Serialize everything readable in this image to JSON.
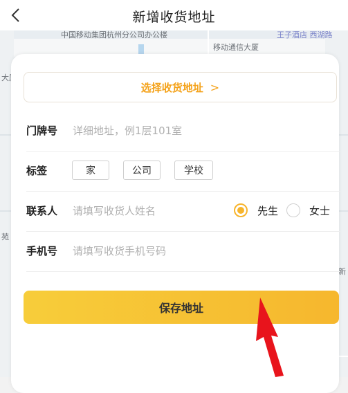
{
  "header": {
    "title": "新增收货地址",
    "back_icon": "chevron-left-icon"
  },
  "map": {
    "labels": {
      "top_left": "中国移动集团杭州分公司办公楼",
      "building": "移动通信大厦",
      "top_right": "王子酒店 西湖路",
      "left_edge": "大厦",
      "left_edge2": "苑",
      "right_edge": "新"
    }
  },
  "form": {
    "select_address": {
      "label": "选择收货地址",
      "chevron": ">"
    },
    "doorplate": {
      "label": "门牌号",
      "placeholder": "详细地址，例1层101室"
    },
    "tag": {
      "label": "标签",
      "options": [
        "家",
        "公司",
        "学校"
      ]
    },
    "contact": {
      "label": "联系人",
      "placeholder": "请填写收货人姓名",
      "gender_options": [
        "先生",
        "女士"
      ],
      "selected_gender": "先生"
    },
    "phone": {
      "label": "手机号",
      "placeholder": "请填写收货手机号码"
    },
    "save_button": "保存地址"
  },
  "colors": {
    "accent": "#f4a21a",
    "button_gradient_start": "#f7cd3a",
    "button_gradient_end": "#f6b72e",
    "arrow": "#e8141c"
  }
}
